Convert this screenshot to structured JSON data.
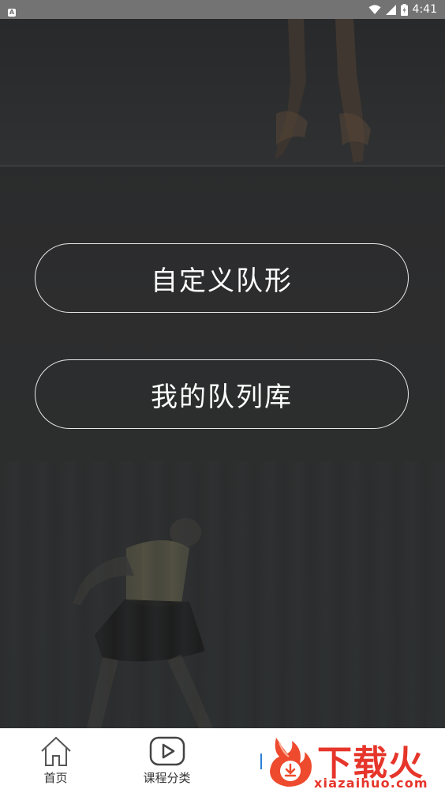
{
  "status_bar": {
    "time": "4:41",
    "badge_letter": "A",
    "icons": [
      "wifi-icon",
      "cellular-signal-icon",
      "battery-icon"
    ]
  },
  "main": {
    "buttons": [
      {
        "label": "自定义队形"
      },
      {
        "label": "我的队列库"
      }
    ]
  },
  "bottom_nav": {
    "items": [
      {
        "label": "首页",
        "icon": "home-icon"
      },
      {
        "label": "课程分类",
        "icon": "play-icon"
      },
      {
        "label": "",
        "icon": ""
      },
      {
        "label": "",
        "icon": ""
      }
    ]
  },
  "watermark": {
    "brand": "下载火",
    "url": "xiazaihuo.com",
    "icon": "flame-download-icon"
  },
  "colors": {
    "status_bar_bg": "#737373",
    "nav_bg": "#ffffff",
    "watermark_red": "#e6352a",
    "button_border": "#e8e8e8"
  }
}
